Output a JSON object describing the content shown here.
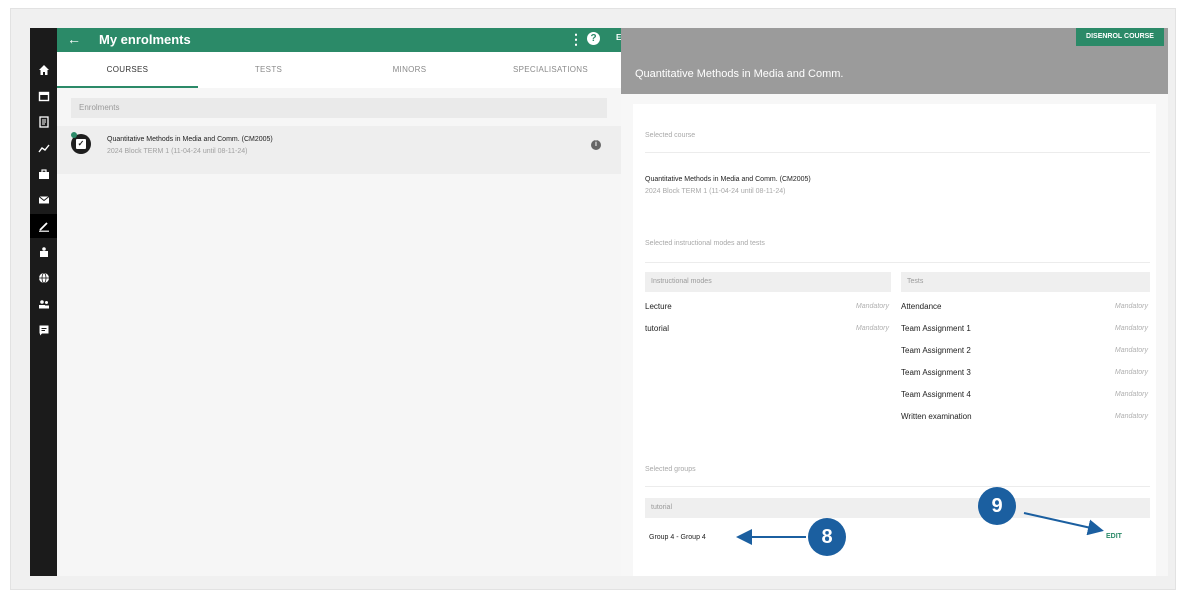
{
  "header": {
    "title": "My enrolments",
    "user_initial": "E",
    "help_glyph": "?",
    "more_glyph": "⋮"
  },
  "tabs": [
    {
      "label": "COURSES",
      "active": true
    },
    {
      "label": "TESTS",
      "active": false
    },
    {
      "label": "MINORS",
      "active": false
    },
    {
      "label": "SPECIALISATIONS",
      "active": false
    }
  ],
  "sidebar": {
    "icons": [
      "home-icon",
      "calendar-icon",
      "document-icon",
      "chart-icon",
      "briefcase-icon",
      "mail-icon",
      "edit-icon",
      "school-icon",
      "globe-icon",
      "people-icon",
      "feedback-icon"
    ],
    "active_index": 6
  },
  "enrolments": {
    "section_label": "Enrolments",
    "course": {
      "title": "Quantitative Methods in Media and Comm. (CM2005)",
      "subtitle": "2024 Block TERM 1 (11-04-24 until 08-11-24)"
    }
  },
  "detail": {
    "title": "Quantitative Methods in Media and Comm.",
    "disenrol_label": "DISENROL COURSE",
    "selected_course_label": "Selected course",
    "course_title": "Quantitative Methods in Media and Comm. (CM2005)",
    "course_subtitle": "2024 Block TERM 1 (11-04-24 until 08-11-24)",
    "modes_tests_label": "Selected instructional modes and tests",
    "modes_header": "Instructional modes",
    "tests_header": "Tests",
    "modes": [
      {
        "name": "Lecture",
        "req": "Mandatory"
      },
      {
        "name": "tutorial",
        "req": "Mandatory"
      }
    ],
    "tests": [
      {
        "name": "Attendance",
        "req": "Mandatory"
      },
      {
        "name": "Team Assignment 1",
        "req": "Mandatory"
      },
      {
        "name": "Team Assignment 2",
        "req": "Mandatory"
      },
      {
        "name": "Team Assignment 3",
        "req": "Mandatory"
      },
      {
        "name": "Team Assignment 4",
        "req": "Mandatory"
      },
      {
        "name": "Written examination",
        "req": "Mandatory"
      }
    ],
    "groups_label": "Selected groups",
    "groups_header": "tutorial",
    "group_value": "Group 4 - Group 4",
    "edit_label": "EDIT"
  },
  "annotations": {
    "callout_8": "8",
    "callout_9": "9",
    "color": "#1b5fa0"
  },
  "colors": {
    "accent": "#2b8a68",
    "rail": "#1b1b1b",
    "header_gray": "#9b9b9b"
  }
}
